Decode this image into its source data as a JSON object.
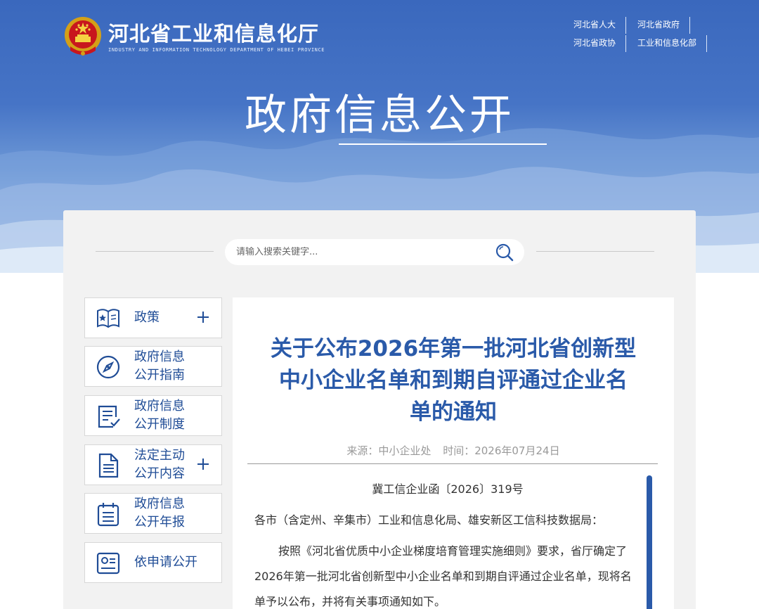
{
  "header": {
    "org_name_cn": "河北省工业和信息化厅",
    "org_name_en": "INDUSTRY AND INFORMATION TECHNOLOGY DEPARTMENT OF HEBEI PROVINCE",
    "top_links": [
      {
        "label": "河北省人大"
      },
      {
        "label": "河北省政府"
      },
      {
        "label": "河北省政协"
      },
      {
        "label": "工业和信息化部"
      }
    ]
  },
  "hero": {
    "title": "政府信息公开"
  },
  "search": {
    "placeholder": "请输入搜索关键字..."
  },
  "sidebar": {
    "items": [
      {
        "line1": "政策",
        "line2": "",
        "icon": "book-star-icon",
        "expandable": true
      },
      {
        "line1": "政府信息",
        "line2": "公开指南",
        "icon": "compass-icon",
        "expandable": false
      },
      {
        "line1": "政府信息",
        "line2": "公开制度",
        "icon": "checklist-icon",
        "expandable": false
      },
      {
        "line1": "法定主动",
        "line2": "公开内容",
        "icon": "document-icon",
        "expandable": true
      },
      {
        "line1": "政府信息",
        "line2": "公开年报",
        "icon": "calendar-list-icon",
        "expandable": false
      },
      {
        "line1": "依申请公开",
        "line2": "",
        "icon": "id-card-icon",
        "expandable": false
      }
    ]
  },
  "article": {
    "title_lines": [
      "关于公布2026年第一批河北省创新型",
      "中小企业名单和到期自评通过企业名",
      "单的通知"
    ],
    "source": "来源：中小企业处",
    "time": "时间：2026年07月24日",
    "doc_number": "冀工信企业函〔2026〕319号",
    "paragraphs": [
      "各市（含定州、辛集市）工业和信息化局、雄安新区工信科技数据局：",
      "按照《河北省优质中小企业梯度培育管理实施细则》要求，省厅确定了2026年第一批河北省创新型中小企业名单和到期自评通过企业名单，现将名单予以公布，并将有关事项通知如下。"
    ]
  },
  "colors": {
    "brand_blue": "#2a5aa9",
    "hero_blue": "#3a68bd",
    "panel_bg": "#f2f2f2"
  }
}
